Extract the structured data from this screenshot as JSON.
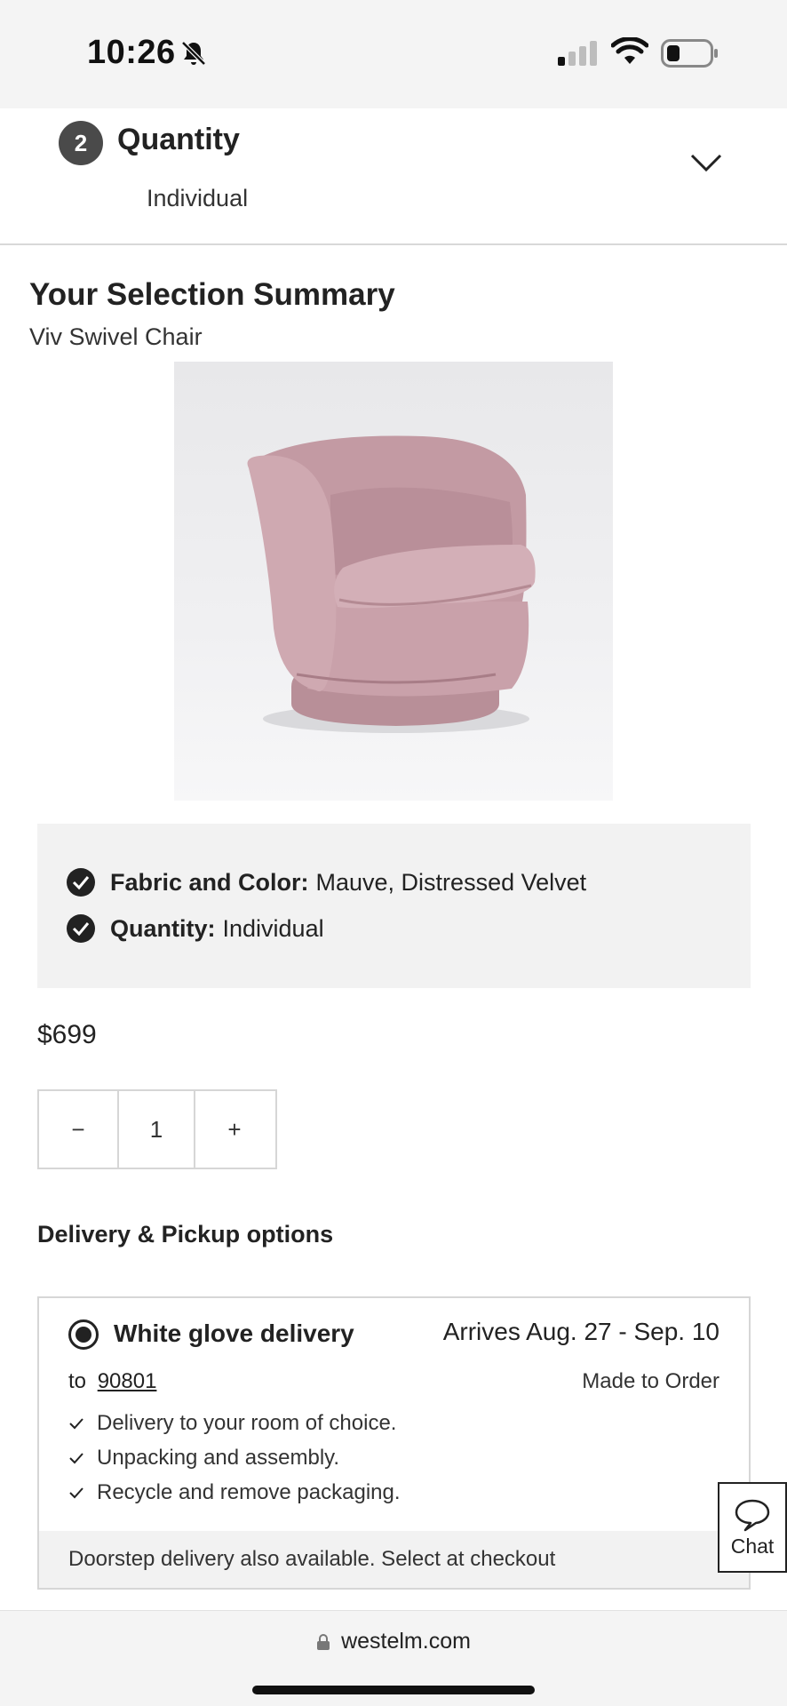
{
  "status_bar": {
    "time": "10:26",
    "icons": [
      "bell-slash-icon",
      "signal-icon",
      "wifi-icon",
      "battery-icon"
    ]
  },
  "step": {
    "number": "2",
    "title": "Quantity",
    "value": "Individual",
    "icon": "chevron-down-icon"
  },
  "summary": {
    "title": "Your Selection Summary",
    "product_name": "Viv Swivel Chair",
    "selections": [
      {
        "label": "Fabric and Color:",
        "value": "Mauve, Distressed Velvet"
      },
      {
        "label": "Quantity:",
        "value": "Individual"
      }
    ],
    "price": "$699"
  },
  "quantity_stepper": {
    "minus": "−",
    "value": "1",
    "plus": "+"
  },
  "delivery": {
    "heading": "Delivery & Pickup options",
    "option_title": "White glove delivery",
    "arrives": "Arrives Aug. 27 - Sep. 10",
    "to_label": "to",
    "zip": "90801",
    "made_to_order": "Made to Order",
    "features": [
      "Delivery to your room of choice.",
      "Unpacking and assembly.",
      "Recycle and remove packaging."
    ],
    "footer": "Doorstep delivery also available. Select at checkout"
  },
  "chat": {
    "label": "Chat"
  },
  "browser": {
    "url": "westelm.com"
  },
  "colors": {
    "product": "#c9a3ab",
    "panel": "#f2f2f2",
    "text": "#222222"
  }
}
